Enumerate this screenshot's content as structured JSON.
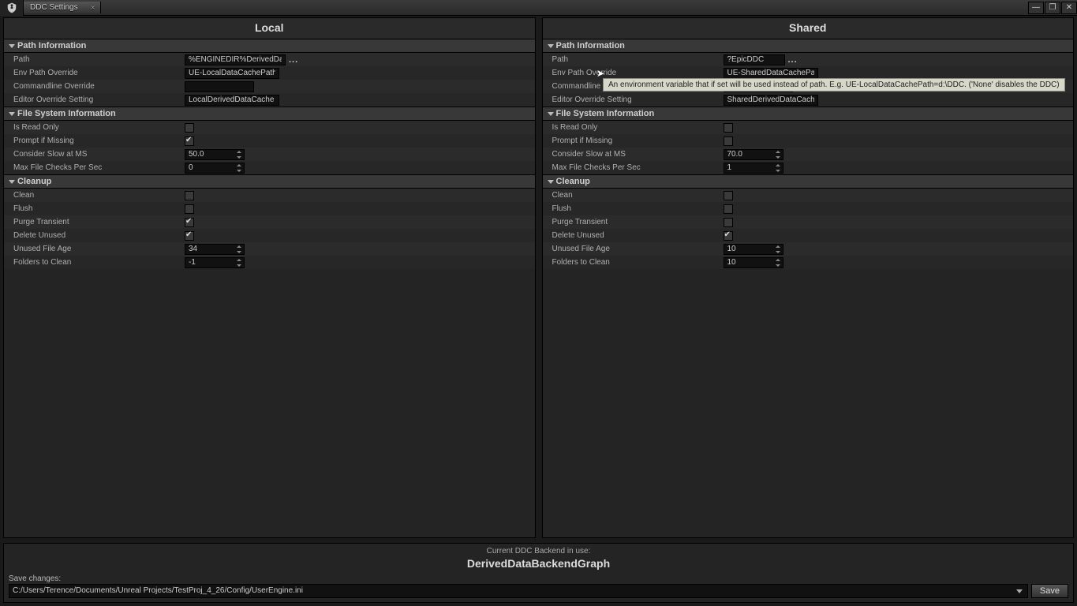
{
  "window": {
    "tab": "DDC Settings"
  },
  "tooltip": "An environment variable that if set will be used instead of path. E.g. UE-LocalDataCachePath=d:\\DDC. ('None' disables the DDC)",
  "panels": {
    "local": {
      "title": "Local",
      "path_info": {
        "header": "Path Information",
        "path_label": "Path",
        "path_value": "%ENGINEDIR%DerivedDataCache",
        "env_label": "Env Path Override",
        "env_value": "UE-LocalDataCachePath",
        "cmd_label": "Commandline Override",
        "cmd_value": "",
        "editor_label": "Editor Override Setting",
        "editor_value": "LocalDerivedDataCache"
      },
      "fs_info": {
        "header": "File System Information",
        "readonly_label": "Is Read Only",
        "readonly": false,
        "prompt_label": "Prompt if Missing",
        "prompt": true,
        "slow_label": "Consider Slow at MS",
        "slow_value": "50.0",
        "max_label": "Max File Checks Per Sec",
        "max_value": "0"
      },
      "cleanup": {
        "header": "Cleanup",
        "clean_label": "Clean",
        "clean": false,
        "flush_label": "Flush",
        "flush": false,
        "purge_label": "Purge Transient",
        "purge": true,
        "delete_label": "Delete Unused",
        "delete": true,
        "age_label": "Unused File Age",
        "age_value": "34",
        "folders_label": "Folders to Clean",
        "folders_value": "-1"
      }
    },
    "shared": {
      "title": "Shared",
      "path_info": {
        "header": "Path Information",
        "path_label": "Path",
        "path_value": "?EpicDDC",
        "env_label": "Env Path Override",
        "env_value": "UE-SharedDataCachePath",
        "cmd_label": "Commandline Override",
        "cmd_value": "",
        "editor_label": "Editor Override Setting",
        "editor_value": "SharedDerivedDataCache"
      },
      "fs_info": {
        "header": "File System Information",
        "readonly_label": "Is Read Only",
        "readonly": false,
        "prompt_label": "Prompt if Missing",
        "prompt": false,
        "slow_label": "Consider Slow at MS",
        "slow_value": "70.0",
        "max_label": "Max File Checks Per Sec",
        "max_value": "1"
      },
      "cleanup": {
        "header": "Cleanup",
        "clean_label": "Clean",
        "clean": false,
        "flush_label": "Flush",
        "flush": false,
        "purge_label": "Purge Transient",
        "purge": false,
        "delete_label": "Delete Unused",
        "delete": true,
        "age_label": "Unused File Age",
        "age_value": "10",
        "folders_label": "Folders to Clean",
        "folders_value": "10"
      }
    }
  },
  "footer": {
    "backend_label": "Current DDC Backend in use:",
    "backend_name": "DerivedDataBackendGraph",
    "save_label": "Save changes:",
    "save_path": "C:/Users/Terence/Documents/Unreal Projects/TestProj_4_26/Config/UserEngine.ini",
    "save_button": "Save"
  }
}
